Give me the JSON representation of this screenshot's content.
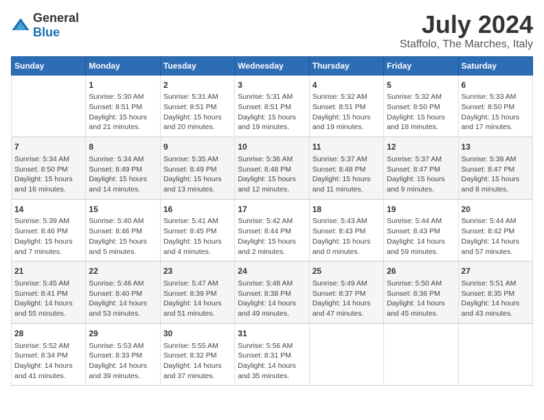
{
  "logo": {
    "general": "General",
    "blue": "Blue"
  },
  "title": "July 2024",
  "location": "Staffolo, The Marches, Italy",
  "weekdays": [
    "Sunday",
    "Monday",
    "Tuesday",
    "Wednesday",
    "Thursday",
    "Friday",
    "Saturday"
  ],
  "weeks": [
    [
      {
        "day": "",
        "info": ""
      },
      {
        "day": "1",
        "info": "Sunrise: 5:30 AM\nSunset: 8:51 PM\nDaylight: 15 hours\nand 21 minutes."
      },
      {
        "day": "2",
        "info": "Sunrise: 5:31 AM\nSunset: 8:51 PM\nDaylight: 15 hours\nand 20 minutes."
      },
      {
        "day": "3",
        "info": "Sunrise: 5:31 AM\nSunset: 8:51 PM\nDaylight: 15 hours\nand 19 minutes."
      },
      {
        "day": "4",
        "info": "Sunrise: 5:32 AM\nSunset: 8:51 PM\nDaylight: 15 hours\nand 19 minutes."
      },
      {
        "day": "5",
        "info": "Sunrise: 5:32 AM\nSunset: 8:50 PM\nDaylight: 15 hours\nand 18 minutes."
      },
      {
        "day": "6",
        "info": "Sunrise: 5:33 AM\nSunset: 8:50 PM\nDaylight: 15 hours\nand 17 minutes."
      }
    ],
    [
      {
        "day": "7",
        "info": "Sunrise: 5:34 AM\nSunset: 8:50 PM\nDaylight: 15 hours\nand 16 minutes."
      },
      {
        "day": "8",
        "info": "Sunrise: 5:34 AM\nSunset: 8:49 PM\nDaylight: 15 hours\nand 14 minutes."
      },
      {
        "day": "9",
        "info": "Sunrise: 5:35 AM\nSunset: 8:49 PM\nDaylight: 15 hours\nand 13 minutes."
      },
      {
        "day": "10",
        "info": "Sunrise: 5:36 AM\nSunset: 8:48 PM\nDaylight: 15 hours\nand 12 minutes."
      },
      {
        "day": "11",
        "info": "Sunrise: 5:37 AM\nSunset: 8:48 PM\nDaylight: 15 hours\nand 11 minutes."
      },
      {
        "day": "12",
        "info": "Sunrise: 5:37 AM\nSunset: 8:47 PM\nDaylight: 15 hours\nand 9 minutes."
      },
      {
        "day": "13",
        "info": "Sunrise: 5:38 AM\nSunset: 8:47 PM\nDaylight: 15 hours\nand 8 minutes."
      }
    ],
    [
      {
        "day": "14",
        "info": "Sunrise: 5:39 AM\nSunset: 8:46 PM\nDaylight: 15 hours\nand 7 minutes."
      },
      {
        "day": "15",
        "info": "Sunrise: 5:40 AM\nSunset: 8:46 PM\nDaylight: 15 hours\nand 5 minutes."
      },
      {
        "day": "16",
        "info": "Sunrise: 5:41 AM\nSunset: 8:45 PM\nDaylight: 15 hours\nand 4 minutes."
      },
      {
        "day": "17",
        "info": "Sunrise: 5:42 AM\nSunset: 8:44 PM\nDaylight: 15 hours\nand 2 minutes."
      },
      {
        "day": "18",
        "info": "Sunrise: 5:43 AM\nSunset: 8:43 PM\nDaylight: 15 hours\nand 0 minutes."
      },
      {
        "day": "19",
        "info": "Sunrise: 5:44 AM\nSunset: 8:43 PM\nDaylight: 14 hours\nand 59 minutes."
      },
      {
        "day": "20",
        "info": "Sunrise: 5:44 AM\nSunset: 8:42 PM\nDaylight: 14 hours\nand 57 minutes."
      }
    ],
    [
      {
        "day": "21",
        "info": "Sunrise: 5:45 AM\nSunset: 8:41 PM\nDaylight: 14 hours\nand 55 minutes."
      },
      {
        "day": "22",
        "info": "Sunrise: 5:46 AM\nSunset: 8:40 PM\nDaylight: 14 hours\nand 53 minutes."
      },
      {
        "day": "23",
        "info": "Sunrise: 5:47 AM\nSunset: 8:39 PM\nDaylight: 14 hours\nand 51 minutes."
      },
      {
        "day": "24",
        "info": "Sunrise: 5:48 AM\nSunset: 8:38 PM\nDaylight: 14 hours\nand 49 minutes."
      },
      {
        "day": "25",
        "info": "Sunrise: 5:49 AM\nSunset: 8:37 PM\nDaylight: 14 hours\nand 47 minutes."
      },
      {
        "day": "26",
        "info": "Sunrise: 5:50 AM\nSunset: 8:36 PM\nDaylight: 14 hours\nand 45 minutes."
      },
      {
        "day": "27",
        "info": "Sunrise: 5:51 AM\nSunset: 8:35 PM\nDaylight: 14 hours\nand 43 minutes."
      }
    ],
    [
      {
        "day": "28",
        "info": "Sunrise: 5:52 AM\nSunset: 8:34 PM\nDaylight: 14 hours\nand 41 minutes."
      },
      {
        "day": "29",
        "info": "Sunrise: 5:53 AM\nSunset: 8:33 PM\nDaylight: 14 hours\nand 39 minutes."
      },
      {
        "day": "30",
        "info": "Sunrise: 5:55 AM\nSunset: 8:32 PM\nDaylight: 14 hours\nand 37 minutes."
      },
      {
        "day": "31",
        "info": "Sunrise: 5:56 AM\nSunset: 8:31 PM\nDaylight: 14 hours\nand 35 minutes."
      },
      {
        "day": "",
        "info": ""
      },
      {
        "day": "",
        "info": ""
      },
      {
        "day": "",
        "info": ""
      }
    ]
  ]
}
